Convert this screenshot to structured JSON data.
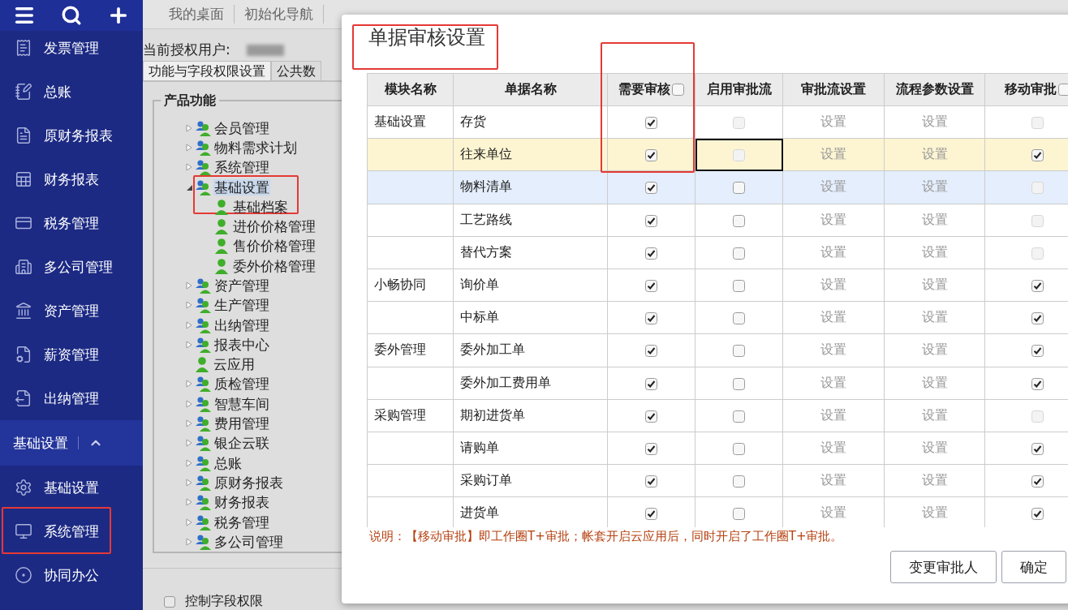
{
  "sidebar": {
    "items": [
      {
        "label": "发票管理",
        "annotated": false
      },
      {
        "label": "总账",
        "annotated": false
      },
      {
        "label": "原财务报表",
        "annotated": false
      },
      {
        "label": "财务报表",
        "annotated": false
      },
      {
        "label": "税务管理",
        "annotated": false
      },
      {
        "label": "多公司管理",
        "annotated": false
      },
      {
        "label": "资产管理",
        "annotated": false
      },
      {
        "label": "薪资管理",
        "annotated": false
      },
      {
        "label": "出纳管理",
        "annotated": false
      }
    ],
    "section": {
      "label": "基础设置",
      "expanded": true,
      "items": [
        {
          "label": "基础设置",
          "annotated": false
        },
        {
          "label": "系统管理",
          "annotated": true
        },
        {
          "label": "协同办公",
          "annotated": false
        }
      ]
    }
  },
  "top_tabs": [
    "我的桌面",
    "初始化导航"
  ],
  "auth_user_label": "当前授权用户:",
  "permission_tabs": [
    {
      "label": "功能与字段权限设置",
      "selected": true
    },
    {
      "label": "公共数",
      "selected": false
    }
  ],
  "product_functions": {
    "legend": "产品功能",
    "tree": [
      {
        "label": "会员管理",
        "kind": "group",
        "expanded": false,
        "selected": false,
        "annotated": false
      },
      {
        "label": "物料需求计划",
        "kind": "group",
        "expanded": false,
        "selected": false,
        "annotated": false
      },
      {
        "label": "系统管理",
        "kind": "group",
        "expanded": false,
        "selected": false,
        "annotated": false
      },
      {
        "label": "基础设置",
        "kind": "group",
        "expanded": true,
        "selected": true,
        "annotated": true,
        "children": [
          {
            "label": "基础档案",
            "kind": "leaf",
            "selected": false
          },
          {
            "label": "进价价格管理",
            "kind": "leaf",
            "selected": false
          },
          {
            "label": "售价价格管理",
            "kind": "leaf",
            "selected": false
          },
          {
            "label": "委外价格管理",
            "kind": "leaf",
            "selected": false
          }
        ]
      },
      {
        "label": "资产管理",
        "kind": "group",
        "expanded": false,
        "selected": false,
        "annotated": false
      },
      {
        "label": "生产管理",
        "kind": "group",
        "expanded": false,
        "selected": false,
        "annotated": false
      },
      {
        "label": "出纳管理",
        "kind": "group",
        "expanded": false,
        "selected": false,
        "annotated": false
      },
      {
        "label": "报表中心",
        "kind": "group",
        "expanded": false,
        "selected": false,
        "annotated": false
      },
      {
        "label": "云应用",
        "kind": "leaf",
        "selected": false
      },
      {
        "label": "质检管理",
        "kind": "group",
        "expanded": false,
        "selected": false,
        "annotated": false
      },
      {
        "label": "智慧车间",
        "kind": "group",
        "expanded": false,
        "selected": false,
        "annotated": false
      },
      {
        "label": "费用管理",
        "kind": "group",
        "expanded": false,
        "selected": false,
        "annotated": false
      },
      {
        "label": "银企云联",
        "kind": "group",
        "expanded": false,
        "selected": false,
        "annotated": false
      },
      {
        "label": "总账",
        "kind": "group",
        "expanded": false,
        "selected": false,
        "annotated": false
      },
      {
        "label": "原财务报表",
        "kind": "group",
        "expanded": false,
        "selected": false,
        "annotated": false
      },
      {
        "label": "财务报表",
        "kind": "group",
        "expanded": false,
        "selected": false,
        "annotated": false
      },
      {
        "label": "税务管理",
        "kind": "group",
        "expanded": false,
        "selected": false,
        "annotated": false
      },
      {
        "label": "多公司管理",
        "kind": "group",
        "expanded": false,
        "selected": false,
        "annotated": false
      }
    ]
  },
  "control_field_permission": {
    "label": "控制字段权限",
    "checked": false
  },
  "dialog": {
    "title": "单据审核设置",
    "annotated": true,
    "columns": [
      {
        "label": "模块名称",
        "annotated": false
      },
      {
        "label": "单据名称",
        "annotated": false
      },
      {
        "label": "需要审核",
        "annotated": true,
        "checkbox": {
          "checked": false
        }
      },
      {
        "label": "启用审批流",
        "annotated": false
      },
      {
        "label": "审批流设置",
        "annotated": false
      },
      {
        "label": "流程参数设置",
        "annotated": false
      },
      {
        "label": "移动审批",
        "annotated": false,
        "checkbox": {
          "checked": false
        }
      }
    ],
    "rows": [
      {
        "module": "基础设置",
        "name": "存货",
        "selected": false,
        "hovered": false,
        "review": true,
        "flow": {
          "checked": false,
          "disabled": true,
          "focused": false
        },
        "flow_setting": "设置",
        "param_setting": "设置",
        "mobile": {
          "checked": false,
          "disabled": true
        }
      },
      {
        "name": "往来单位",
        "selected": true,
        "hovered": false,
        "review": true,
        "flow": {
          "checked": false,
          "disabled": true,
          "focused": true
        },
        "flow_setting": "设置",
        "param_setting": "设置",
        "mobile": {
          "checked": true,
          "disabled": false
        }
      },
      {
        "name": "物料清单",
        "selected": false,
        "hovered": true,
        "review": true,
        "flow": {
          "checked": false,
          "disabled": false,
          "focused": false
        },
        "flow_setting": "设置",
        "param_setting": "设置",
        "mobile": {
          "checked": false,
          "disabled": true
        }
      },
      {
        "name": "工艺路线",
        "selected": false,
        "hovered": false,
        "review": true,
        "flow": {
          "checked": false,
          "disabled": false,
          "focused": false
        },
        "flow_setting": "设置",
        "param_setting": "设置",
        "mobile": {
          "checked": false,
          "disabled": true
        }
      },
      {
        "name": "替代方案",
        "selected": false,
        "hovered": false,
        "review": true,
        "flow": {
          "checked": false,
          "disabled": false,
          "focused": false
        },
        "flow_setting": "设置",
        "param_setting": "设置",
        "mobile": {
          "checked": false,
          "disabled": true
        }
      },
      {
        "module": "小畅协同",
        "name": "询价单",
        "selected": false,
        "hovered": false,
        "review": true,
        "flow": {
          "checked": false,
          "disabled": false,
          "focused": false
        },
        "flow_setting": "设置",
        "param_setting": "设置",
        "mobile": {
          "checked": true,
          "disabled": false
        }
      },
      {
        "name": "中标单",
        "selected": false,
        "hovered": false,
        "review": true,
        "flow": {
          "checked": false,
          "disabled": false,
          "focused": false
        },
        "flow_setting": "设置",
        "param_setting": "设置",
        "mobile": {
          "checked": true,
          "disabled": false
        }
      },
      {
        "module": "委外管理",
        "name": "委外加工单",
        "selected": false,
        "hovered": false,
        "review": true,
        "flow": {
          "checked": false,
          "disabled": false,
          "focused": false
        },
        "flow_setting": "设置",
        "param_setting": "设置",
        "mobile": {
          "checked": true,
          "disabled": false
        }
      },
      {
        "name": "委外加工费用单",
        "selected": false,
        "hovered": false,
        "review": true,
        "flow": {
          "checked": false,
          "disabled": false,
          "focused": false
        },
        "flow_setting": "设置",
        "param_setting": "设置",
        "mobile": {
          "checked": true,
          "disabled": false
        }
      },
      {
        "module": "采购管理",
        "name": "期初进货单",
        "selected": false,
        "hovered": false,
        "review": true,
        "flow": {
          "checked": false,
          "disabled": false,
          "focused": false
        },
        "flow_setting": "设置",
        "param_setting": "设置",
        "mobile": {
          "checked": false,
          "disabled": true
        }
      },
      {
        "name": "请购单",
        "selected": false,
        "hovered": false,
        "review": true,
        "flow": {
          "checked": false,
          "disabled": false,
          "focused": false
        },
        "flow_setting": "设置",
        "param_setting": "设置",
        "mobile": {
          "checked": true,
          "disabled": false
        }
      },
      {
        "name": "采购订单",
        "selected": false,
        "hovered": false,
        "review": true,
        "flow": {
          "checked": false,
          "disabled": false,
          "focused": false
        },
        "flow_setting": "设置",
        "param_setting": "设置",
        "mobile": {
          "checked": true,
          "disabled": false
        }
      },
      {
        "name": "进货单",
        "selected": false,
        "hovered": false,
        "review": true,
        "flow": {
          "checked": false,
          "disabled": false,
          "focused": false
        },
        "flow_setting": "设置",
        "param_setting": "设置",
        "mobile": {
          "checked": true,
          "disabled": false
        }
      }
    ],
    "note": "说明：【移动审批】即工作圈T+审批；帐套开启云应用后，同时开启了工作圈T+审批。",
    "buttons": [
      "变更审批人",
      "确定"
    ]
  }
}
